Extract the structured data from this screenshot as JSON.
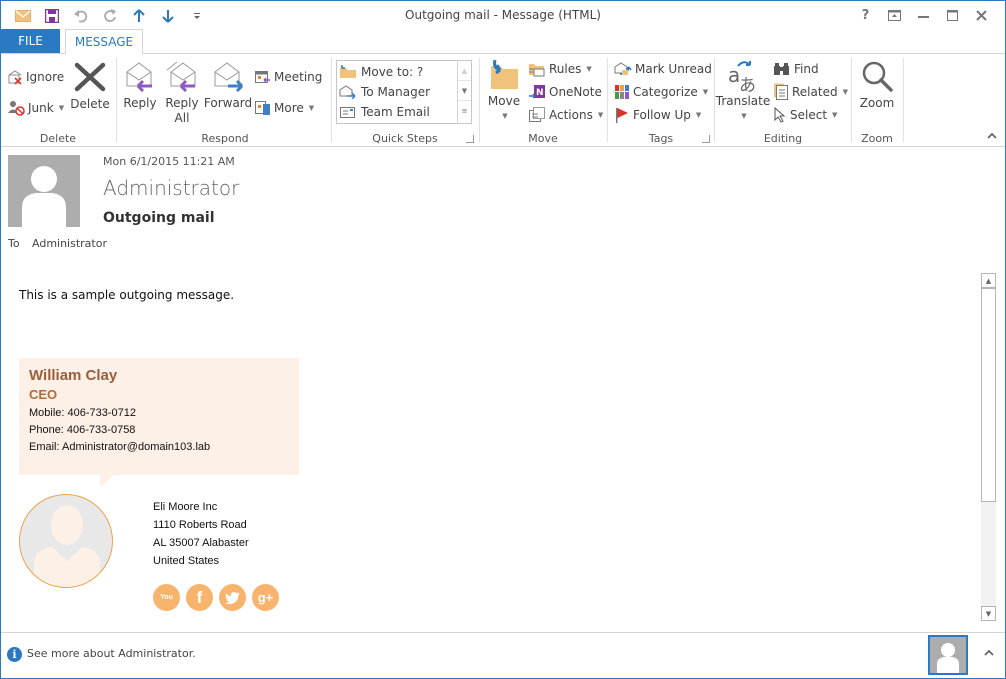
{
  "window": {
    "title": "Outgoing mail - Message (HTML)",
    "controls": [
      "help",
      "ribbon-display-options",
      "minimize",
      "maximize",
      "close"
    ],
    "help_label": "?"
  },
  "quick_access": [
    "mail-icon",
    "save-icon",
    "undo-icon",
    "redo-icon",
    "previous-item-icon",
    "next-item-icon",
    "customize-qat-icon"
  ],
  "tabs": [
    {
      "label": "FILE",
      "active": false
    },
    {
      "label": "MESSAGE",
      "active": true
    }
  ],
  "ribbon": {
    "groups": {
      "delete": {
        "label": "Delete",
        "ignore": "Ignore",
        "junk": "Junk",
        "delete": "Delete"
      },
      "respond": {
        "label": "Respond",
        "reply": "Reply",
        "reply_all_1": "Reply",
        "reply_all_2": "All",
        "forward": "Forward",
        "meeting": "Meeting",
        "more": "More"
      },
      "quick_steps": {
        "label": "Quick Steps",
        "items": [
          "Move to: ?",
          "To Manager",
          "Team Email"
        ]
      },
      "move": {
        "label": "Move",
        "move": "Move",
        "rules": "Rules",
        "onenote": "OneNote",
        "actions": "Actions"
      },
      "tags": {
        "label": "Tags",
        "mark_unread": "Mark Unread",
        "categorize": "Categorize",
        "follow_up": "Follow Up"
      },
      "editing": {
        "label": "Editing",
        "translate": "Translate",
        "find": "Find",
        "related": "Related",
        "select": "Select"
      },
      "zoom": {
        "label": "Zoom",
        "zoom": "Zoom"
      }
    }
  },
  "message": {
    "date": "Mon 6/1/2015 11:21 AM",
    "sender": "Administrator",
    "subject": "Outgoing mail",
    "to_label": "To",
    "to": "Administrator",
    "body": "This is a sample outgoing message."
  },
  "signature": {
    "name": "William Clay",
    "title": "CEO",
    "mobile": "Mobile: 406-733-0712",
    "phone": "Phone: 406-733-0758",
    "email": "Email: Administrator@domain103.lab",
    "company": "Eli Moore Inc",
    "street": "1110 Roberts Road",
    "city": "AL 35007 Alabaster",
    "country": "United States",
    "social": [
      {
        "name": "youtube",
        "glyph": "You"
      },
      {
        "name": "facebook",
        "glyph": "f"
      },
      {
        "name": "twitter",
        "glyph": "t"
      },
      {
        "name": "google-plus",
        "glyph": "g+"
      }
    ],
    "colors": {
      "card_bg": "#fdf0e6",
      "name": "#9c5e3b",
      "accent": "#f8b46c"
    }
  },
  "people_pane": {
    "text": "See more about Administrator."
  },
  "colors": {
    "accent": "#2b79c2"
  }
}
